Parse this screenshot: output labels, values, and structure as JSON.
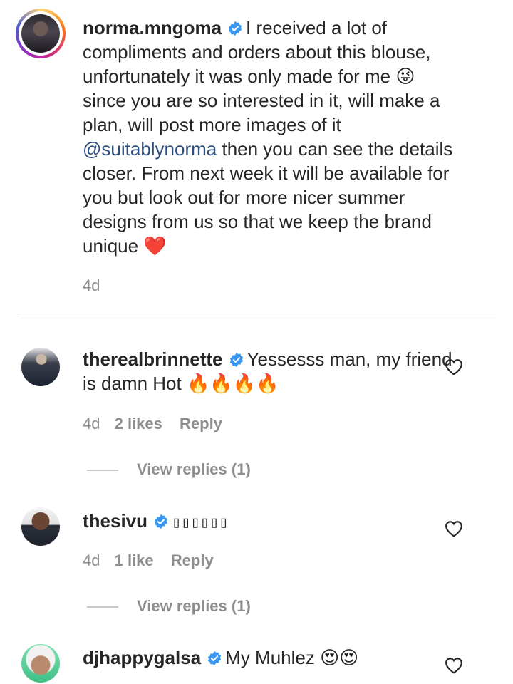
{
  "caption": {
    "username": "norma.mngoma",
    "text_before_mention": "I received a lot of compliments and orders about this blouse, unfortunately it was only made for me 😜 since you are so interested in it, will make a plan, will post more images of it ",
    "mention": "@suitablynorma",
    "text_after_mention": " then you can see the details closer. From next week it will be available for you but look out for more nicer summer designs from us so that we keep the brand unique ❤️",
    "time": "4d"
  },
  "comments": [
    {
      "username": "therealbrinnette",
      "text": "Yessesss man, my friend is damn Hot 🔥🔥🔥🔥",
      "time": "4d",
      "likes": "2 likes",
      "reply_label": "Reply",
      "view_replies": "View replies (1)"
    },
    {
      "username": "thesivu",
      "text": "▯▯▯▯▯▯",
      "time": "4d",
      "likes": "1 like",
      "reply_label": "Reply",
      "view_replies": "View replies (1)"
    },
    {
      "username": "djhappygalsa",
      "text": "My Muhlez 😍😍"
    }
  ],
  "colors": {
    "verified": "#3897f0",
    "mention": "#2b4e7d",
    "meta": "#8e8e8e"
  },
  "icons": [
    "verified-badge-icon",
    "heart-outline-icon"
  ]
}
